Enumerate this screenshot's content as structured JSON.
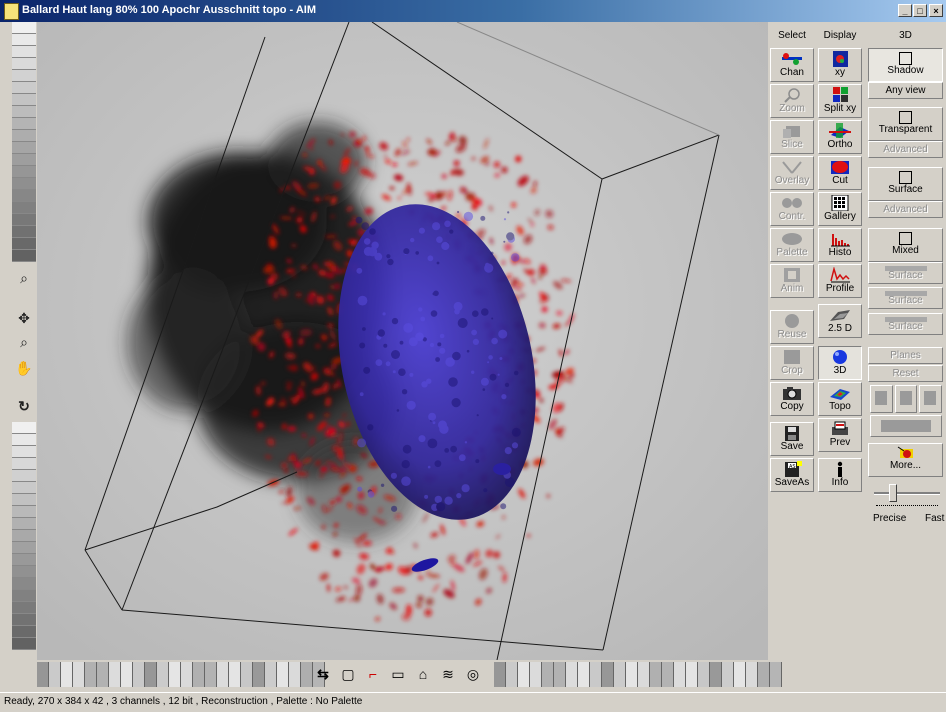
{
  "window": {
    "title": "Ballard Haut lang 80% 100 Apochr Ausschnitt topo - AIM",
    "minimize": "_",
    "maximize": "□",
    "close": "×"
  },
  "columns": {
    "select": "Select",
    "display": "Display",
    "three_d": "3D"
  },
  "select_tools": [
    {
      "label": "Chan",
      "enabled": true,
      "icon": "channels-icon"
    },
    {
      "label": "Zoom",
      "enabled": false,
      "icon": "zoom-icon"
    },
    {
      "label": "Slice",
      "enabled": false,
      "icon": "slice-icon"
    },
    {
      "label": "Overlay",
      "enabled": false,
      "icon": "overlay-icon"
    },
    {
      "label": "Contr.",
      "enabled": false,
      "icon": "contrast-icon"
    },
    {
      "label": "Palette",
      "enabled": false,
      "icon": "palette-icon"
    },
    {
      "label": "Anim",
      "enabled": false,
      "icon": "animation-icon"
    },
    {
      "label": "Reuse",
      "enabled": false,
      "icon": "reuse-icon"
    },
    {
      "label": "Crop",
      "enabled": false,
      "icon": "crop-icon"
    },
    {
      "label": "Copy",
      "enabled": true,
      "icon": "camera-icon"
    },
    {
      "label": "Save",
      "enabled": true,
      "icon": "floppy-icon"
    },
    {
      "label": "SaveAs",
      "enabled": true,
      "icon": "floppy-as-icon"
    }
  ],
  "display_tools": [
    {
      "label": "xy",
      "icon": "xy-view-icon"
    },
    {
      "label": "Split xy",
      "icon": "split-xy-icon"
    },
    {
      "label": "Ortho",
      "icon": "ortho-icon"
    },
    {
      "label": "Cut",
      "icon": "cut-icon"
    },
    {
      "label": "Gallery",
      "icon": "gallery-icon"
    },
    {
      "label": "Histo",
      "icon": "histogram-icon"
    },
    {
      "label": "Profile",
      "icon": "profile-icon"
    },
    {
      "label": "2.5 D",
      "icon": "two-point-five-d-icon"
    },
    {
      "label": "3D",
      "icon": "sphere-icon",
      "pressed": true
    },
    {
      "label": "Topo",
      "icon": "topography-icon"
    },
    {
      "label": "Prev",
      "icon": "print-preview-icon"
    },
    {
      "label": "Info",
      "icon": "info-icon"
    }
  ],
  "three_d_panel": {
    "shadow": "Shadow",
    "any_view": "Any view",
    "transparent": "Transparent",
    "advanced_1": "Advanced",
    "surface": "Surface",
    "advanced_2": "Advanced",
    "mixed": "Mixed",
    "surface_1": "Surface",
    "surface_2": "Surface",
    "surface_3": "Surface",
    "planes": "Planes",
    "reset": "Reset",
    "more": "More...",
    "slider_precise": "Precise",
    "slider_fast": "Fast",
    "slider_value": 0.25
  },
  "status": {
    "text": "Ready, 270 x 384 x 42 , 3 channels , 12 bit , Reconstruction , Palette : No Palette"
  },
  "colors": {
    "red_channel": "#d01818",
    "blue_channel": "#3a2bb0",
    "title_start": "#0a246a",
    "title_end": "#a6caf0"
  }
}
